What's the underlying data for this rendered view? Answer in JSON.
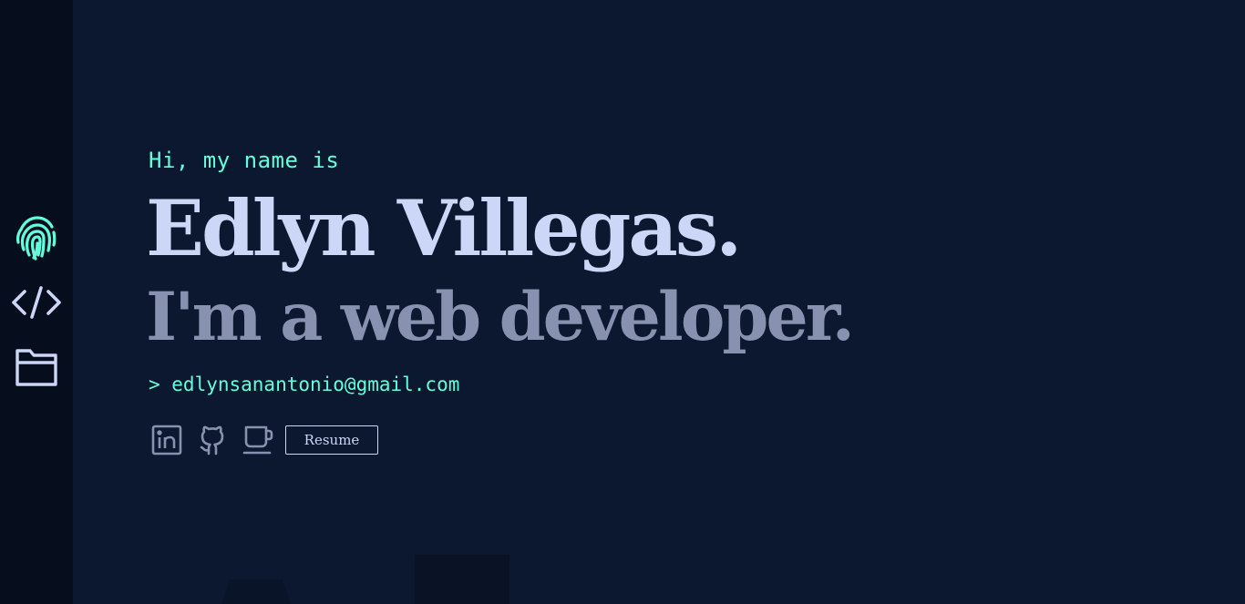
{
  "sidebar": {
    "icons": [
      {
        "name": "fingerprint-icon",
        "color": "#64ffda"
      },
      {
        "name": "code-icon",
        "color": "#ccd6f6"
      },
      {
        "name": "folder-icon",
        "color": "#ccd6f6"
      }
    ]
  },
  "hero": {
    "greeting": "Hi, my name is",
    "name": "Edlyn Villegas.",
    "tagline": "I'm a web developer.",
    "email": "> edlynsanantonio@gmail.com"
  },
  "socials": {
    "links": [
      {
        "icon": "linkedin-icon"
      },
      {
        "icon": "github-icon"
      },
      {
        "icon": "coffee-cup-icon"
      }
    ],
    "resume_label": "Resume"
  },
  "colors": {
    "background": "#0b1830",
    "sidebar": "#060d1d",
    "accent": "#64ffda",
    "heading": "#ccd6f6",
    "subheading": "#8892b0",
    "icon_muted": "#8892b0"
  }
}
